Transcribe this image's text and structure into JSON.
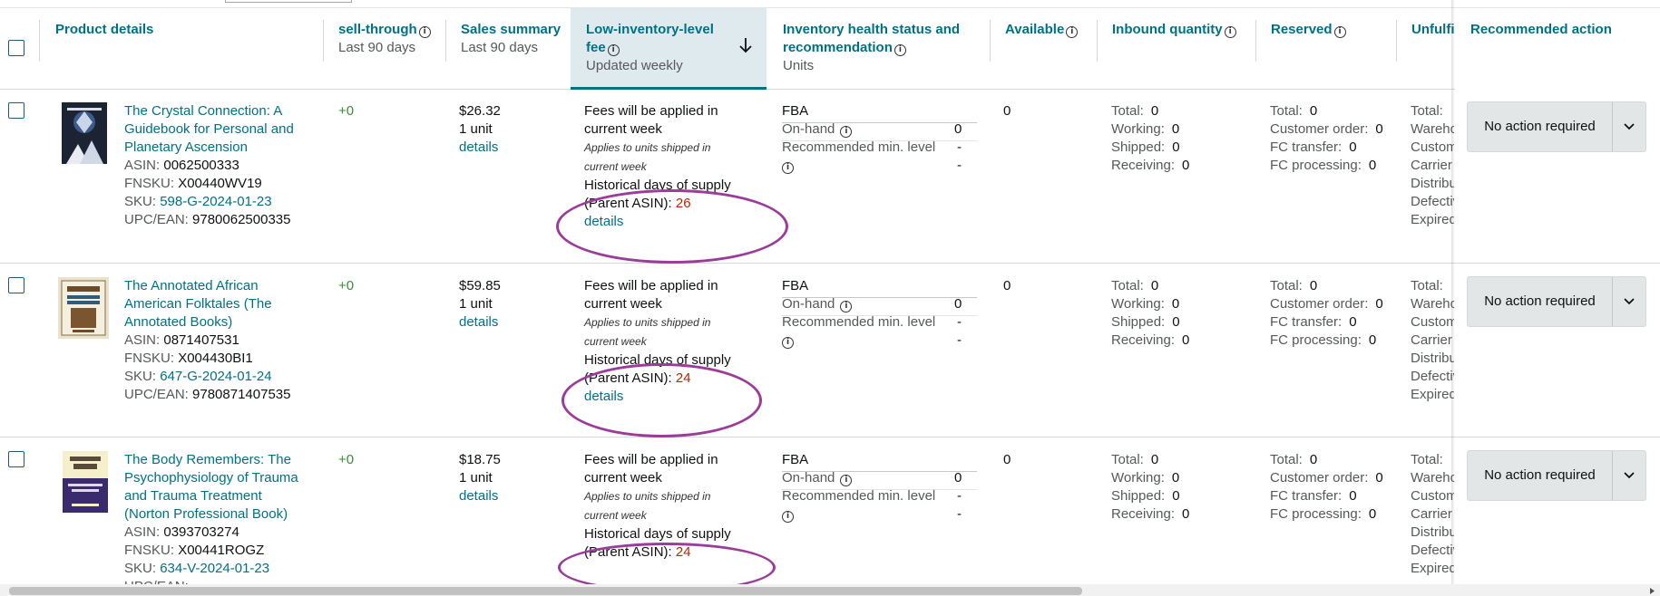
{
  "columns": {
    "product_details": {
      "title": "Product details"
    },
    "sell_through": {
      "title": "sell-through",
      "sub": "Last 90 days"
    },
    "sales_summary": {
      "title": "Sales summary",
      "sub": "Last 90 days"
    },
    "low_inventory_fee": {
      "title_line1": "Low-inventory-level",
      "title_line2": "fee",
      "sub": "Updated weekly"
    },
    "inventory_health": {
      "title_line1": "Inventory health status and",
      "title_line2": "recommendation",
      "sub": "Units"
    },
    "available": {
      "title": "Available"
    },
    "inbound": {
      "title": "Inbound quantity"
    },
    "reserved": {
      "title": "Reserved"
    },
    "unfulfillable": {
      "title": "Unfulfi"
    },
    "recommended_action": {
      "title": "Recommended action"
    }
  },
  "labels": {
    "asin": "ASIN:",
    "fnsku": "FNSKU:",
    "sku": "SKU:",
    "upc": "UPC/EAN:",
    "details": "details",
    "fees_line1": "Fees will be applied in",
    "fees_line2": "current week",
    "applies_line1": "Applies to units shipped in",
    "applies_line2": "current week",
    "hist_line1": "Historical days of supply",
    "hist_line2": "(Parent ASIN):",
    "fba": "FBA",
    "on_hand": "On-hand",
    "rec_min": "Recommended min. level",
    "total": "Total:",
    "working": "Working:",
    "shipped": "Shipped:",
    "receiving": "Receiving:",
    "customer_order": "Customer order:",
    "fc_transfer": "FC transfer:",
    "fc_processing": "FC processing:",
    "unf_labels": [
      "Total:",
      "Wareho",
      "Custom",
      "Carrier",
      "Distribu",
      "Defectiv",
      "Expired"
    ],
    "action": "No action required"
  },
  "rows": [
    {
      "title_lines": [
        "The Crystal Connection: A",
        "Guidebook for Personal and",
        "Planetary Ascension"
      ],
      "asin": "0062500333",
      "fnsku": "X00440WV19",
      "sku": "598-G-2024-01-23",
      "upc": "9780062500335",
      "sell_through": "+0",
      "sales_amount": "$26.32",
      "sales_units": "1 unit",
      "hist_days": "26",
      "on_hand": "0",
      "rec_min_a": "-",
      "rec_min_b": "-",
      "available": "0",
      "inbound": {
        "total": "0",
        "working": "0",
        "shipped": "0",
        "receiving": "0"
      },
      "reserved": {
        "total": "0",
        "customer_order": "0",
        "fc_transfer": "0",
        "fc_processing": "0"
      }
    },
    {
      "title_lines": [
        "The Annotated African",
        "American Folktales (The",
        "Annotated Books)"
      ],
      "asin": "0871407531",
      "fnsku": "X004430BI1",
      "sku": "647-G-2024-01-24",
      "upc": "9780871407535",
      "sell_through": "+0",
      "sales_amount": "$59.85",
      "sales_units": "1 unit",
      "hist_days": "24",
      "on_hand": "0",
      "rec_min_a": "-",
      "rec_min_b": "-",
      "available": "0",
      "inbound": {
        "total": "0",
        "working": "0",
        "shipped": "0",
        "receiving": "0"
      },
      "reserved": {
        "total": "0",
        "customer_order": "0",
        "fc_transfer": "0",
        "fc_processing": "0"
      }
    },
    {
      "title_lines": [
        "The Body Remembers: The",
        "Psychophysiology of Trauma",
        "and Trauma Treatment",
        "(Norton Professional Book)"
      ],
      "asin": "0393703274",
      "fnsku": "X00441ROGZ",
      "sku": "634-V-2024-01-23",
      "upc": "",
      "sell_through": "+0",
      "sales_amount": "$18.75",
      "sales_units": "1 unit",
      "hist_days": "24",
      "on_hand": "0",
      "rec_min_a": "-",
      "rec_min_b": "-",
      "available": "0",
      "inbound": {
        "total": "0",
        "working": "0",
        "shipped": "0",
        "receiving": "0"
      },
      "reserved": {
        "total": "0",
        "customer_order": "0",
        "fc_transfer": "0",
        "fc_processing": "0"
      }
    }
  ],
  "colors": {
    "link": "#007185",
    "accent_ring": "#9b3c9b",
    "highlight_value": "#b12704",
    "positive": "#3a8b3a"
  },
  "icons": {
    "info": "info-circle-icon",
    "sort": "arrow-down-icon",
    "dropdown": "chevron-down-icon"
  }
}
